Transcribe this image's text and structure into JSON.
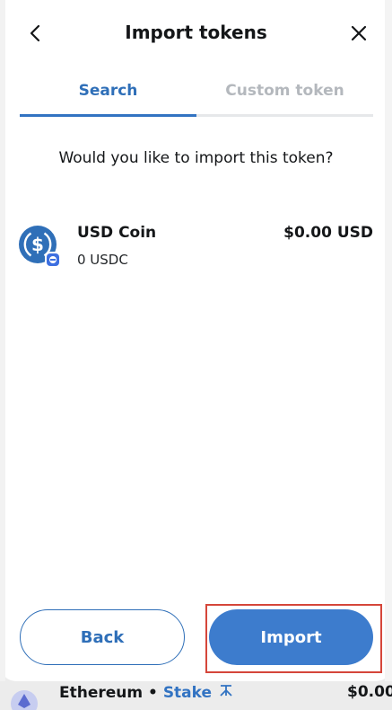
{
  "header": {
    "title": "Import tokens",
    "back_icon": "chevron-left-icon",
    "close_icon": "close-icon"
  },
  "tabs": [
    {
      "label": "Search",
      "active": true
    },
    {
      "label": "Custom token",
      "active": false
    }
  ],
  "prompt": "Would you like to import this token?",
  "token": {
    "name": "USD Coin",
    "amount": "0 USDC",
    "value": "$0.00 USD",
    "icon": "usdc-icon",
    "network_badge": "network-badge-icon"
  },
  "actions": {
    "back_label": "Back",
    "import_label": "Import"
  },
  "background_row": {
    "network": "Ethereum",
    "separator": " • ",
    "stake_label": "Stake",
    "value": "$0.00"
  },
  "colors": {
    "accent": "#3d7ccd",
    "highlight": "#d5463a",
    "inactive_tab": "#b4b8bd"
  }
}
